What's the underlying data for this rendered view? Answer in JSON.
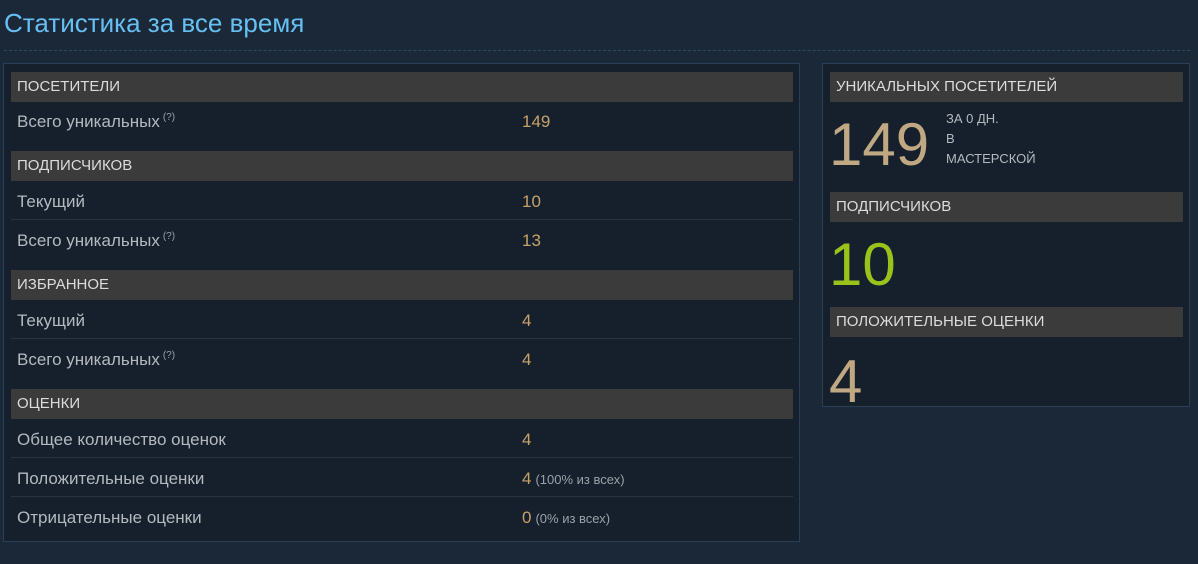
{
  "page": {
    "title": "Статистика за все время"
  },
  "left": {
    "visitors": {
      "header": "ПОСЕТИТЕЛИ",
      "rows": [
        {
          "label": "Всего уникальных",
          "help": "(?)",
          "value": "149"
        }
      ]
    },
    "subscribers": {
      "header": "ПОДПИСЧИКОВ",
      "rows": [
        {
          "label": "Текущий",
          "value": "10"
        },
        {
          "label": "Всего уникальных",
          "help": "(?)",
          "value": "13"
        }
      ]
    },
    "favorites": {
      "header": "ИЗБРАННОЕ",
      "rows": [
        {
          "label": "Текущий",
          "value": "4"
        },
        {
          "label": "Всего уникальных",
          "help": "(?)",
          "value": "4"
        }
      ]
    },
    "ratings": {
      "header": "ОЦЕНКИ",
      "rows": [
        {
          "label": "Общее количество оценок",
          "value": "4"
        },
        {
          "label": "Положительные оценки",
          "value": "4",
          "extra": "(100% из всех)"
        },
        {
          "label": "Отрицательные оценки",
          "value": "0",
          "extra": "(0% из всех)"
        }
      ]
    }
  },
  "right": {
    "unique_visitors": {
      "header": "УНИКАЛЬНЫХ ПОСЕТИТЕЛЕЙ",
      "value": "149",
      "sub1": "ЗА 0 ДН.",
      "sub2": "В",
      "sub3": "МАСТЕРСКОЙ"
    },
    "subscribers": {
      "header": "ПОДПИСЧИКОВ",
      "value": "10"
    },
    "positive": {
      "header": "ПОЛОЖИТЕЛЬНЫЕ ОЦЕНКИ",
      "value": "4"
    }
  },
  "colors": {
    "background": "#1b2838",
    "title": "#66c0f4",
    "value": "#c6a26a",
    "subscribers_big": "#99c31b"
  }
}
